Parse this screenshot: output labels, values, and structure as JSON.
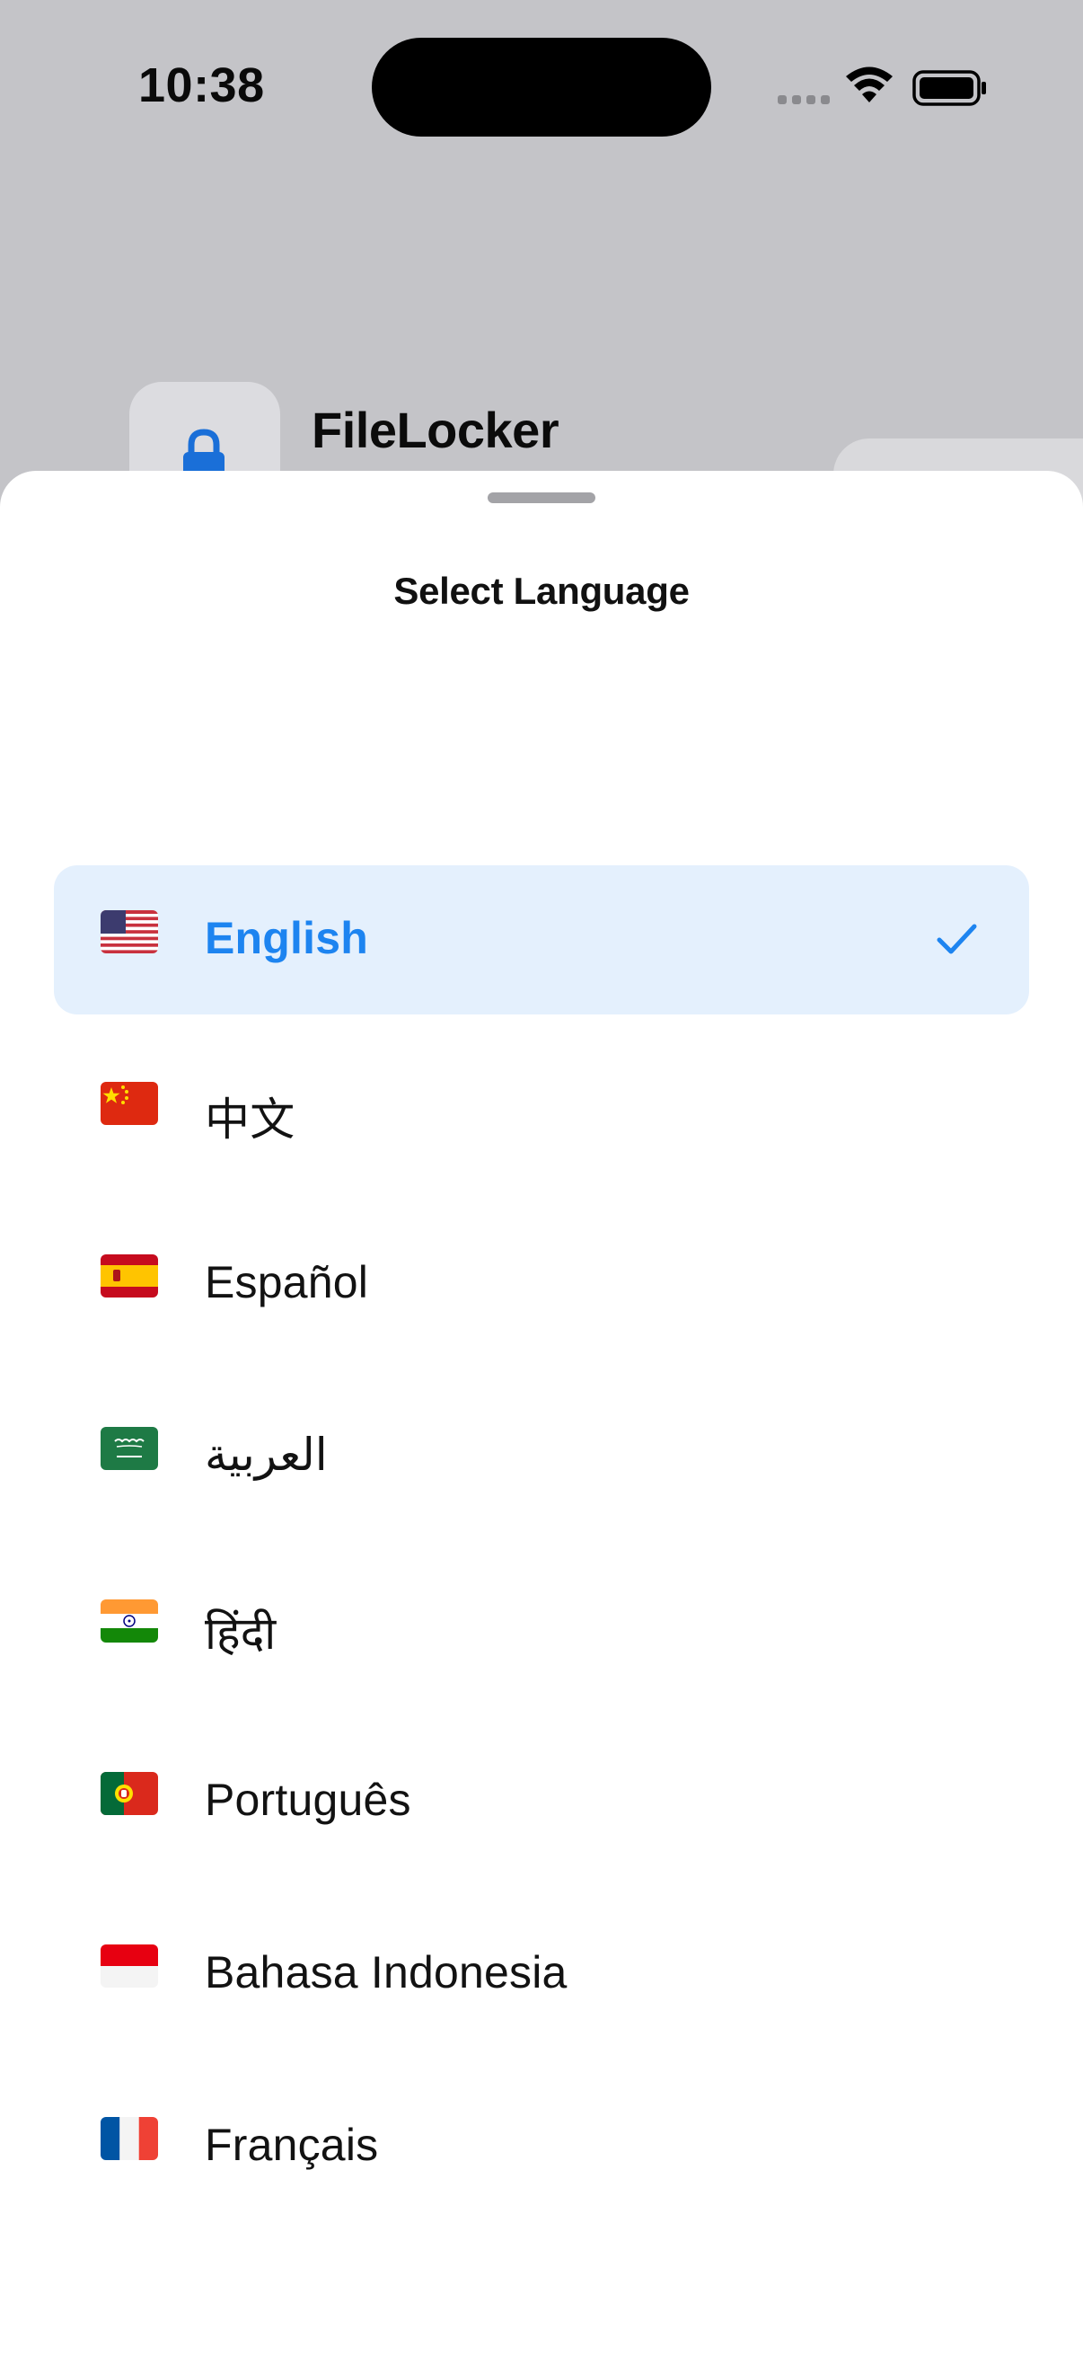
{
  "status_bar": {
    "time": "10:38"
  },
  "background_app": {
    "title": "FileLocker",
    "icon": "lock-icon",
    "accent_color": "#1a6fd8"
  },
  "sheet": {
    "title": "Select Language",
    "selected_index": 0,
    "accent_color": "#1d84f0",
    "selected_bg": "#e4f0fd",
    "languages": [
      {
        "label": "English",
        "flag": "us-flag-icon",
        "selected": true
      },
      {
        "label": "中文",
        "flag": "china-flag-icon",
        "selected": false
      },
      {
        "label": "Español",
        "flag": "spain-flag-icon",
        "selected": false
      },
      {
        "label": "العربية",
        "flag": "saudi-arabia-flag-icon",
        "selected": false
      },
      {
        "label": "हिंदी",
        "flag": "india-flag-icon",
        "selected": false
      },
      {
        "label": "Português",
        "flag": "portugal-flag-icon",
        "selected": false
      },
      {
        "label": "Bahasa Indonesia",
        "flag": "indonesia-flag-icon",
        "selected": false
      },
      {
        "label": "Français",
        "flag": "france-flag-icon",
        "selected": false
      }
    ]
  }
}
